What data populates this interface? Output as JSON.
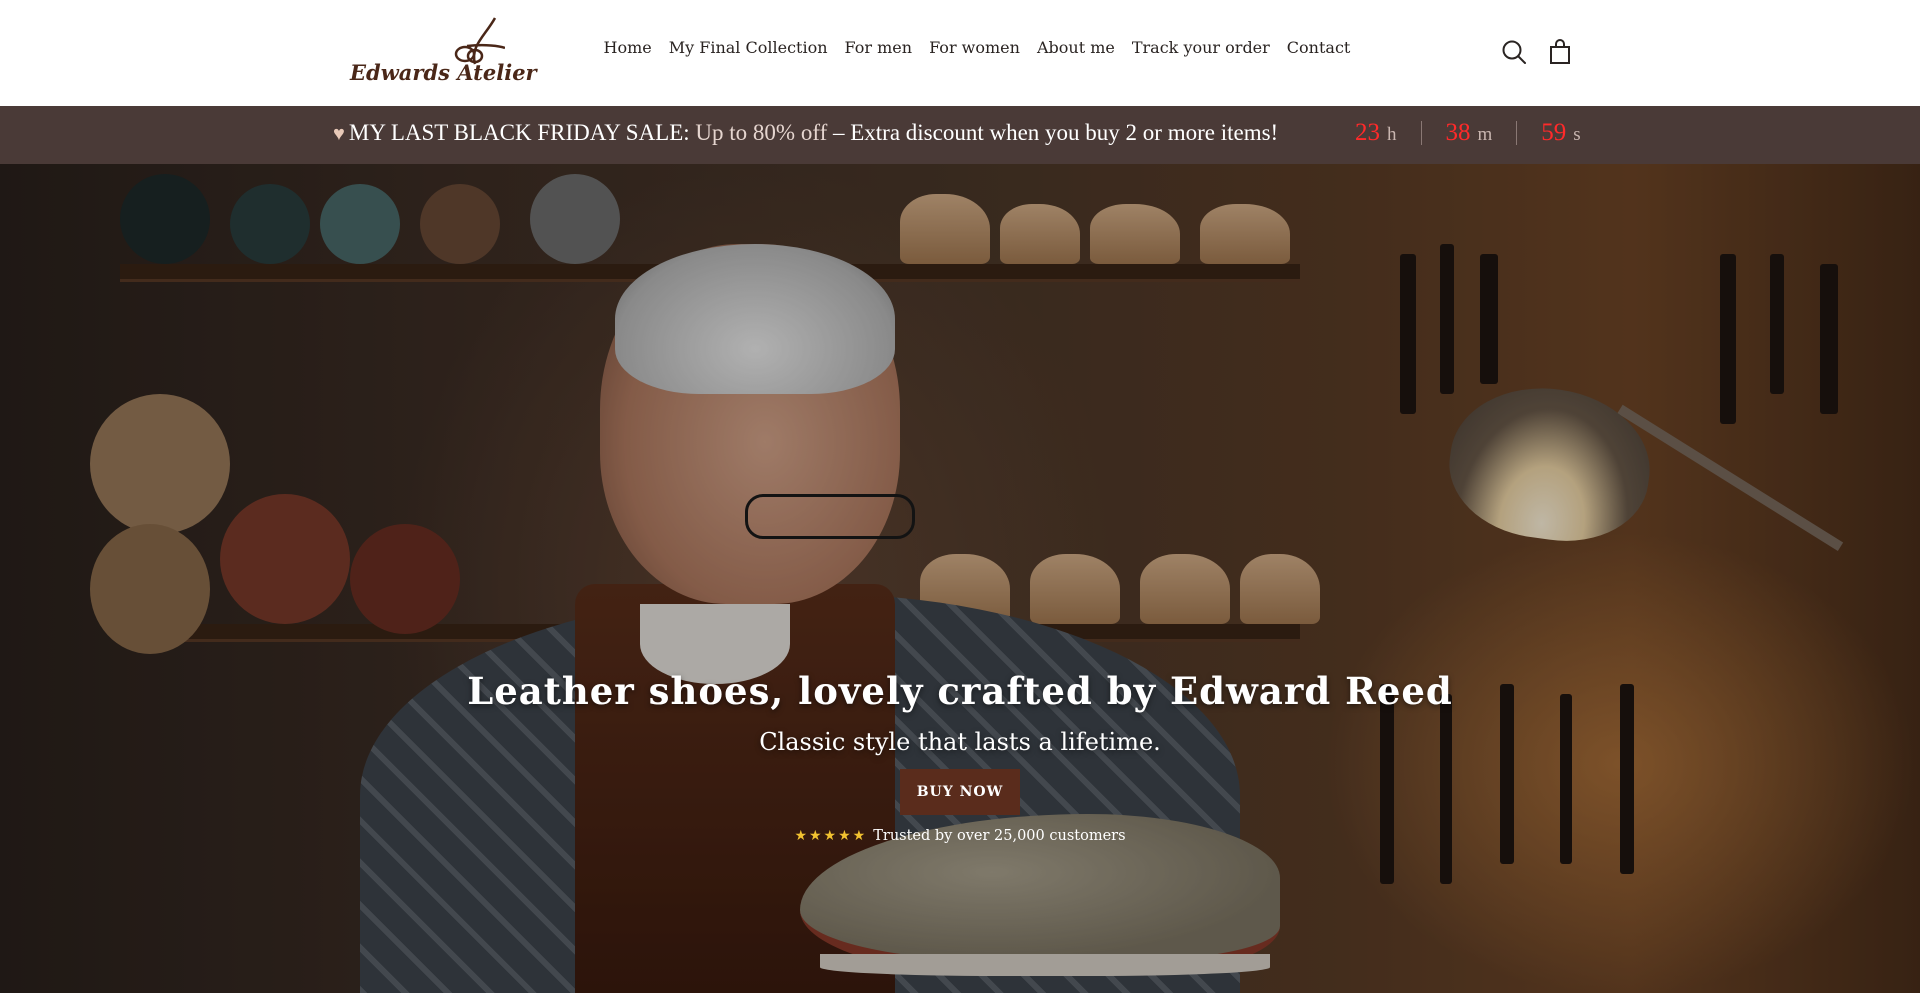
{
  "brand": {
    "logo_text": "Edwards Atelier"
  },
  "nav": {
    "items": [
      {
        "label": "Home"
      },
      {
        "label": "My Final Collection"
      },
      {
        "label": "For men"
      },
      {
        "label": "For women"
      },
      {
        "label": "About me"
      },
      {
        "label": "Track your order"
      },
      {
        "label": "Contact"
      }
    ]
  },
  "header_icons": {
    "search": "search-icon",
    "cart": "cart-icon"
  },
  "announcement": {
    "heart_icon": "heart-icon",
    "lead": "MY LAST BLACK FRIDAY SALE:",
    "highlight": "Up to 80% off",
    "rest": "– Extra discount when you buy 2 or more items!",
    "countdown": {
      "hours": "23",
      "hours_unit": "h",
      "minutes": "38",
      "minutes_unit": "m",
      "seconds": "59",
      "seconds_unit": "s"
    }
  },
  "hero": {
    "title": "Leather shoes, lovely crafted by Edward Reed",
    "subtitle": "Classic style that lasts a lifetime.",
    "button_label": "BUY NOW",
    "rating_stars": "★★★★★",
    "trust_text": "Trusted by over 25,000 customers"
  },
  "colors": {
    "announcement_bg": "#4a3a37",
    "countdown_number": "#ff2a2a",
    "button_bg": "#5a2c1c",
    "star": "#f2c230",
    "logo": "#4a2718"
  }
}
